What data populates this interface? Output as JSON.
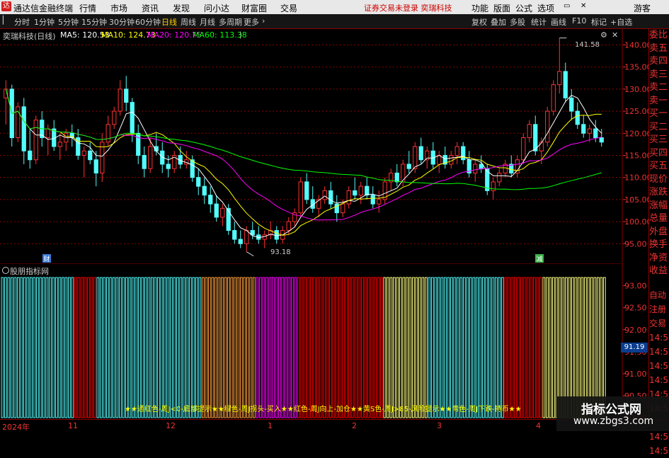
{
  "titlebar": {
    "logo": "达",
    "app_name": "通达信金融终端",
    "menus": [
      "行情",
      "市场",
      "资讯",
      "发现",
      "问小达",
      "财富圈",
      "交易"
    ],
    "notice": "证券交易未登录  奕瑞科技",
    "right_menus": [
      "功能",
      "版面",
      "公式",
      "选项"
    ],
    "user": "游客"
  },
  "toolbar": {
    "periods": [
      "分时",
      "1分钟",
      "5分钟",
      "15分钟",
      "30分钟",
      "60分钟",
      "日线",
      "周线",
      "月线",
      "多周期",
      "更多"
    ],
    "active_period": "日线",
    "tools": [
      "复权",
      "叠加",
      "多股",
      "统计",
      "画线",
      "F10",
      "标记",
      "+自选"
    ]
  },
  "stock": {
    "title": "奕瑞科技(日线)",
    "ma5": "MA5: 120.53",
    "ma10": "MA10: 124.73",
    "ma20": "MA20: 120.75",
    "ma60": "MA60: 113.38",
    "high_label": "141.58",
    "low_label": "93.18",
    "tag_cai": "财",
    "tag_jian": "减"
  },
  "colors": {
    "up": "#ff3232",
    "down": "#54fcfc",
    "ma5": "#ffffff",
    "ma10": "#ffff00",
    "ma20": "#ff00ff",
    "ma60": "#00ff00",
    "grid": "#8b0000"
  },
  "price_axis": [
    "140.00",
    "135.00",
    "130.00",
    "125.00",
    "120.00",
    "115.00",
    "110.00",
    "105.00",
    "100.00",
    "95.00"
  ],
  "indicator": {
    "title": "股朋指标网",
    "legend": "★★通红色-周J<0-底部提示★★绿色-周J拐头-买入★★红色-周J向上-加仓★★黄S色-周J>85-风险提示★★青色-周J下跌-持币★★",
    "axis": [
      "93.00",
      "92.50",
      "92.00",
      "91.50",
      "91.00",
      "90.50",
      "90.00"
    ],
    "cursor_value": "91.19",
    "color_segments": [
      {
        "color": "#54fcfc",
        "from": 0,
        "to": 23
      },
      {
        "color": "#ff0000",
        "from": 23,
        "to": 30
      },
      {
        "color": "#54fcfc",
        "from": 30,
        "to": 63
      },
      {
        "color": "#ffa040",
        "from": 63,
        "to": 80
      },
      {
        "color": "#ff00ff",
        "from": 80,
        "to": 93
      },
      {
        "color": "#ff0000",
        "from": 93,
        "to": 120
      },
      {
        "color": "#ffff80",
        "from": 120,
        "to": 134
      },
      {
        "color": "#54fcfc",
        "from": 134,
        "to": 158
      },
      {
        "color": "#ff0000",
        "from": 158,
        "to": 170
      },
      {
        "color": "#ffff80",
        "from": 170,
        "to": 190
      }
    ]
  },
  "right_panel": [
    "委比",
    "卖五",
    "卖四",
    "卖三",
    "卖二",
    "卖一",
    "买一",
    "买二",
    "买三",
    "买四",
    "买五",
    "现价",
    "涨跌",
    "涨幅",
    "总量",
    "外盘",
    "换手",
    "净资",
    "收益"
  ],
  "right_panel_lower": [
    "自动",
    "注册",
    "交易",
    "14:56",
    "14:56",
    "14:56",
    "14:56",
    "14:56",
    "14:56",
    "14:56",
    "14:56",
    "14:56"
  ],
  "dates": [
    "2024年",
    "11",
    "12",
    "1",
    "2",
    "3",
    "4"
  ],
  "watermark": {
    "line1": "指标公式网",
    "line2": "www.zbgs3.com"
  },
  "chart_data": {
    "type": "candlestick",
    "ylim": [
      92,
      142
    ],
    "candles": [
      [
        128,
        132,
        122,
        130
      ],
      [
        130,
        131,
        117,
        119
      ],
      [
        119,
        127,
        118,
        126
      ],
      [
        126,
        128,
        113,
        116
      ],
      [
        116,
        121,
        112,
        114
      ],
      [
        114,
        124,
        113,
        123
      ],
      [
        123,
        125,
        117,
        119
      ],
      [
        119,
        122,
        115,
        121
      ],
      [
        121,
        123,
        116,
        117
      ],
      [
        117,
        120,
        114,
        118
      ],
      [
        118,
        121,
        116,
        120
      ],
      [
        120,
        122,
        117,
        119
      ],
      [
        119,
        121,
        114,
        115
      ],
      [
        115,
        117,
        110,
        116
      ],
      [
        116,
        118,
        113,
        114
      ],
      [
        114,
        116,
        108,
        111
      ],
      [
        111,
        120,
        109,
        118
      ],
      [
        118,
        124,
        117,
        122
      ],
      [
        122,
        126,
        121,
        125
      ],
      [
        125,
        132,
        124,
        130
      ],
      [
        130,
        133,
        125,
        127
      ],
      [
        127,
        128,
        118,
        120
      ],
      [
        120,
        122,
        113,
        115
      ],
      [
        115,
        117,
        110,
        112
      ],
      [
        112,
        119,
        111,
        117
      ],
      [
        117,
        120,
        115,
        116
      ],
      [
        116,
        118,
        111,
        113
      ],
      [
        113,
        115,
        110,
        112
      ],
      [
        112,
        116,
        111,
        115
      ],
      [
        115,
        117,
        112,
        113
      ],
      [
        113,
        116,
        112,
        114
      ],
      [
        114,
        115,
        109,
        110
      ],
      [
        110,
        112,
        106,
        108
      ],
      [
        108,
        110,
        104,
        106
      ],
      [
        106,
        108,
        102,
        104
      ],
      [
        104,
        106,
        100,
        101
      ],
      [
        101,
        104,
        99,
        103
      ],
      [
        103,
        104,
        97,
        98
      ],
      [
        98,
        100,
        95,
        96
      ],
      [
        96,
        98,
        94,
        95
      ],
      [
        95,
        99,
        93.18,
        98
      ],
      [
        98,
        100,
        96,
        97
      ],
      [
        97,
        99,
        95,
        96
      ],
      [
        96,
        98,
        94,
        97
      ],
      [
        97,
        100,
        96,
        98
      ],
      [
        98,
        99,
        95,
        96
      ],
      [
        96,
        99,
        95,
        98
      ],
      [
        98,
        101,
        97,
        100
      ],
      [
        100,
        103,
        99,
        102
      ],
      [
        102,
        110,
        101,
        109
      ],
      [
        109,
        111,
        104,
        105
      ],
      [
        105,
        108,
        102,
        103
      ],
      [
        103,
        106,
        101,
        105
      ],
      [
        105,
        108,
        104,
        107
      ],
      [
        107,
        109,
        103,
        104
      ],
      [
        104,
        106,
        100,
        102
      ],
      [
        102,
        105,
        101,
        104
      ],
      [
        104,
        108,
        103,
        107
      ],
      [
        107,
        110,
        105,
        106
      ],
      [
        106,
        109,
        104,
        108
      ],
      [
        108,
        110,
        105,
        106
      ],
      [
        106,
        108,
        103,
        104
      ],
      [
        104,
        107,
        102,
        105
      ],
      [
        105,
        110,
        104,
        109
      ],
      [
        109,
        112,
        107,
        111
      ],
      [
        111,
        113,
        108,
        109
      ],
      [
        109,
        114,
        108,
        113
      ],
      [
        113,
        116,
        111,
        112
      ],
      [
        112,
        118,
        111,
        117
      ],
      [
        117,
        119,
        113,
        114
      ],
      [
        114,
        117,
        112,
        116
      ],
      [
        116,
        118,
        112,
        113
      ],
      [
        113,
        116,
        111,
        115
      ],
      [
        115,
        117,
        112,
        113
      ],
      [
        113,
        116,
        112,
        115
      ],
      [
        115,
        118,
        113,
        117
      ],
      [
        117,
        118,
        113,
        114
      ],
      [
        114,
        116,
        110,
        111
      ],
      [
        111,
        114,
        109,
        113
      ],
      [
        113,
        115,
        111,
        112
      ],
      [
        112,
        113,
        106,
        107
      ],
      [
        107,
        110,
        105,
        109
      ],
      [
        109,
        112,
        108,
        111
      ],
      [
        111,
        114,
        110,
        113
      ],
      [
        113,
        115,
        110,
        111
      ],
      [
        111,
        115,
        110,
        114
      ],
      [
        114,
        120,
        113,
        119
      ],
      [
        119,
        123,
        118,
        122
      ],
      [
        122,
        124,
        115,
        116
      ],
      [
        116,
        119,
        113,
        118
      ],
      [
        118,
        126,
        117,
        125
      ],
      [
        125,
        132,
        124,
        131
      ],
      [
        131,
        141.58,
        129,
        134
      ],
      [
        134,
        136,
        127,
        128
      ],
      [
        128,
        130,
        123,
        125
      ],
      [
        125,
        127,
        121,
        122
      ],
      [
        122,
        124,
        119,
        120
      ],
      [
        120,
        122,
        118,
        121
      ],
      [
        121,
        123,
        118,
        119
      ],
      [
        119,
        121,
        117,
        118
      ]
    ]
  }
}
